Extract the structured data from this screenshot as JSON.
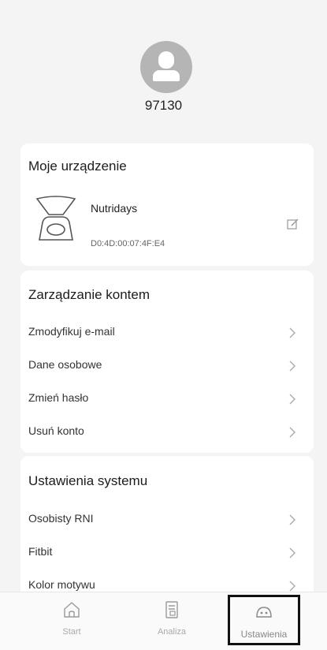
{
  "profile": {
    "username": "97130"
  },
  "device_section": {
    "title": "Moje urządzenie",
    "device": {
      "name": "Nutridays",
      "mac": "D0:4D:00:07:4F:E4"
    }
  },
  "account_section": {
    "title": "Zarządzanie kontem",
    "items": [
      {
        "label": "Zmodyfikuj e-mail"
      },
      {
        "label": "Dane osobowe"
      },
      {
        "label": "Zmień hasło"
      },
      {
        "label": "Usuń konto"
      }
    ]
  },
  "system_section": {
    "title": "Ustawienia systemu",
    "items": [
      {
        "label": "Osobisty RNI"
      },
      {
        "label": "Fitbit"
      },
      {
        "label": "Kolor motywu"
      }
    ]
  },
  "tabbar": {
    "tabs": [
      {
        "label": "Start",
        "icon": "home-icon"
      },
      {
        "label": "Analiza",
        "icon": "analysis-icon"
      },
      {
        "label": "Ustawienia",
        "icon": "settings-icon",
        "active": true
      }
    ]
  }
}
